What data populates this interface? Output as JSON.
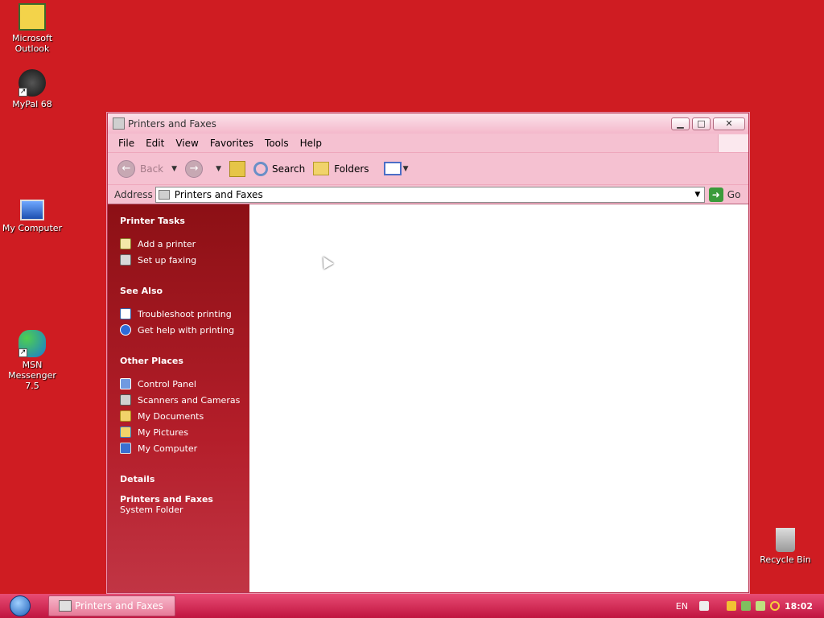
{
  "desktop": {
    "icons": [
      {
        "label": "Microsoft Outlook"
      },
      {
        "label": "MyPal 68"
      },
      {
        "label": "My Computer"
      },
      {
        "label": "MSN Messenger 7.5"
      },
      {
        "label": "Recycle Bin"
      }
    ]
  },
  "window": {
    "title": "Printers and Faxes",
    "menu": [
      "File",
      "Edit",
      "View",
      "Favorites",
      "Tools",
      "Help"
    ],
    "toolbar": {
      "back": "Back",
      "search": "Search",
      "folders": "Folders"
    },
    "address": {
      "label": "Address",
      "value": "Printers and Faxes",
      "go": "Go"
    },
    "taskpane": {
      "printer_tasks": {
        "title": "Printer Tasks",
        "items": [
          "Add a printer",
          "Set up faxing"
        ]
      },
      "see_also": {
        "title": "See Also",
        "items": [
          "Troubleshoot printing",
          "Get help with printing"
        ]
      },
      "other_places": {
        "title": "Other Places",
        "items": [
          "Control Panel",
          "Scanners and Cameras",
          "My Documents",
          "My Pictures",
          "My Computer"
        ]
      },
      "details": {
        "title": "Details",
        "name": "Printers and Faxes",
        "type": "System Folder"
      }
    }
  },
  "taskbar": {
    "task": "Printers and Faxes",
    "language": "EN",
    "clock": "18:02"
  },
  "colors": {
    "desktop": "#cf1c22",
    "taskpane": "#b41e2a"
  }
}
